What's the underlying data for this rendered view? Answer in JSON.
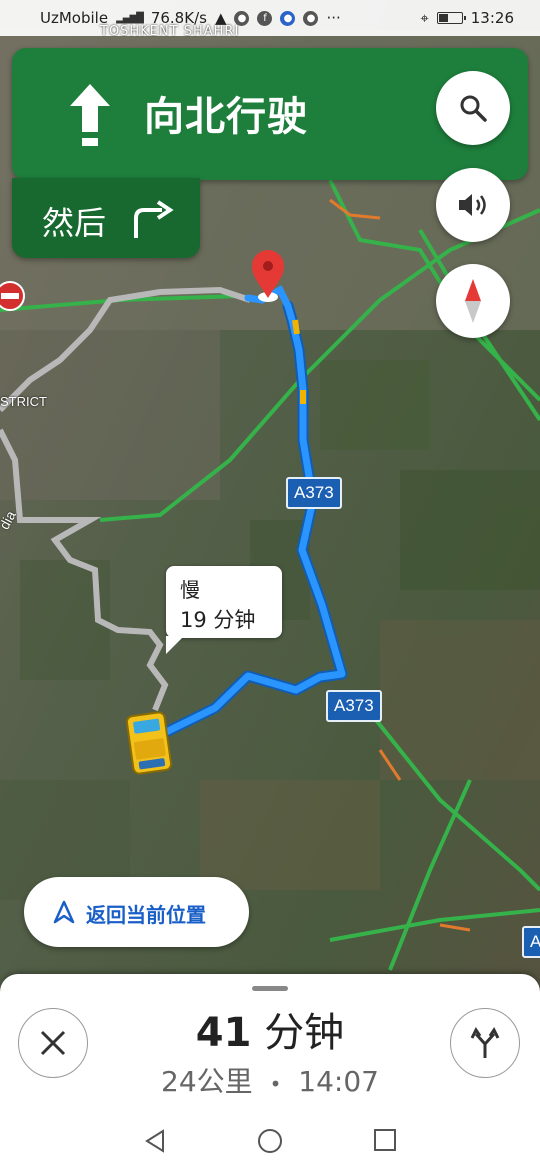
{
  "status_bar": {
    "carrier": "UzMobile",
    "speed": "76.8K/s",
    "time": "13:26"
  },
  "map_labels": {
    "top_city": "TOSHKENT SHAHRI",
    "district": "STRICT",
    "district_left": "dia"
  },
  "navigation": {
    "instruction": "向北行驶",
    "then_label": "然后",
    "then_icon": "turn-right-icon"
  },
  "buttons": {
    "search_icon": "search-icon",
    "sound_icon": "volume-icon",
    "compass_icon": "compass-icon"
  },
  "road_shields": [
    "A373",
    "A373",
    "A"
  ],
  "callout": {
    "line1": "慢",
    "line2": "19 分钟"
  },
  "recenter": {
    "label": "返回当前位置"
  },
  "trip": {
    "duration_value": "41",
    "duration_unit": "分钟",
    "distance": "24公里",
    "separator": "•",
    "arrival": "14:07"
  },
  "colors": {
    "banner_green": "#1e7f3c",
    "banner_dark_green": "#17692f",
    "route_blue": "#1a73e8",
    "shield_blue": "#1b5fb3",
    "recenter_blue": "#1a5fc8"
  }
}
